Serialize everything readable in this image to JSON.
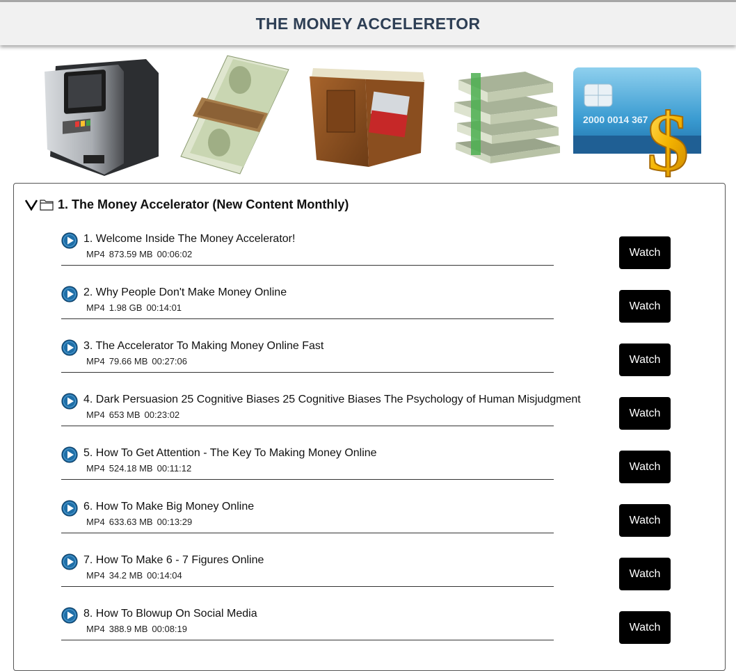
{
  "header": {
    "title": "THE MONEY ACCELERETOR"
  },
  "banner": {
    "images": [
      "atm-machine-icon",
      "cash-bundle-icon",
      "wallet-icon",
      "money-stacks-icon",
      "credit-card-dollar-icon"
    ],
    "card_number": "2000 0014 367"
  },
  "folder": {
    "title": "1. The Money Accelerator (New Content Monthly)",
    "expanded": true
  },
  "items": [
    {
      "title": "1. Welcome Inside The Money Accelerator!",
      "format": "MP4",
      "size": "873.59 MB",
      "duration": "00:06:02",
      "button": "Watch"
    },
    {
      "title": "2. Why People Don't Make Money Online",
      "format": "MP4",
      "size": "1.98 GB",
      "duration": "00:14:01",
      "button": "Watch"
    },
    {
      "title": "3. The Accelerator To Making Money Online Fast",
      "format": "MP4",
      "size": "79.66 MB",
      "duration": "00:27:06",
      "button": "Watch"
    },
    {
      "title": "4. Dark Persuasion 25 Cognitive Biases 25 Cognitive Biases The Psychology of Human Misjudgment",
      "format": "MP4",
      "size": "653 MB",
      "duration": "00:23:02",
      "button": "Watch"
    },
    {
      "title": "5. How To Get Attention - The Key To Making Money Online",
      "format": "MP4",
      "size": "524.18 MB",
      "duration": "00:11:12",
      "button": "Watch"
    },
    {
      "title": "6. How To Make Big Money Online",
      "format": "MP4",
      "size": "633.63 MB",
      "duration": "00:13:29",
      "button": "Watch"
    },
    {
      "title": "7. How To Make 6 - 7 Figures Online",
      "format": "MP4",
      "size": "34.2 MB",
      "duration": "00:14:04",
      "button": "Watch"
    },
    {
      "title": "8. How To Blowup On Social Media",
      "format": "MP4",
      "size": "388.9 MB",
      "duration": "00:08:19",
      "button": "Watch"
    }
  ],
  "colors": {
    "header_text": "#2e3f55",
    "header_bg": "#f1f1f1",
    "button_bg": "#000000",
    "play_icon": "#1f6fa8"
  }
}
